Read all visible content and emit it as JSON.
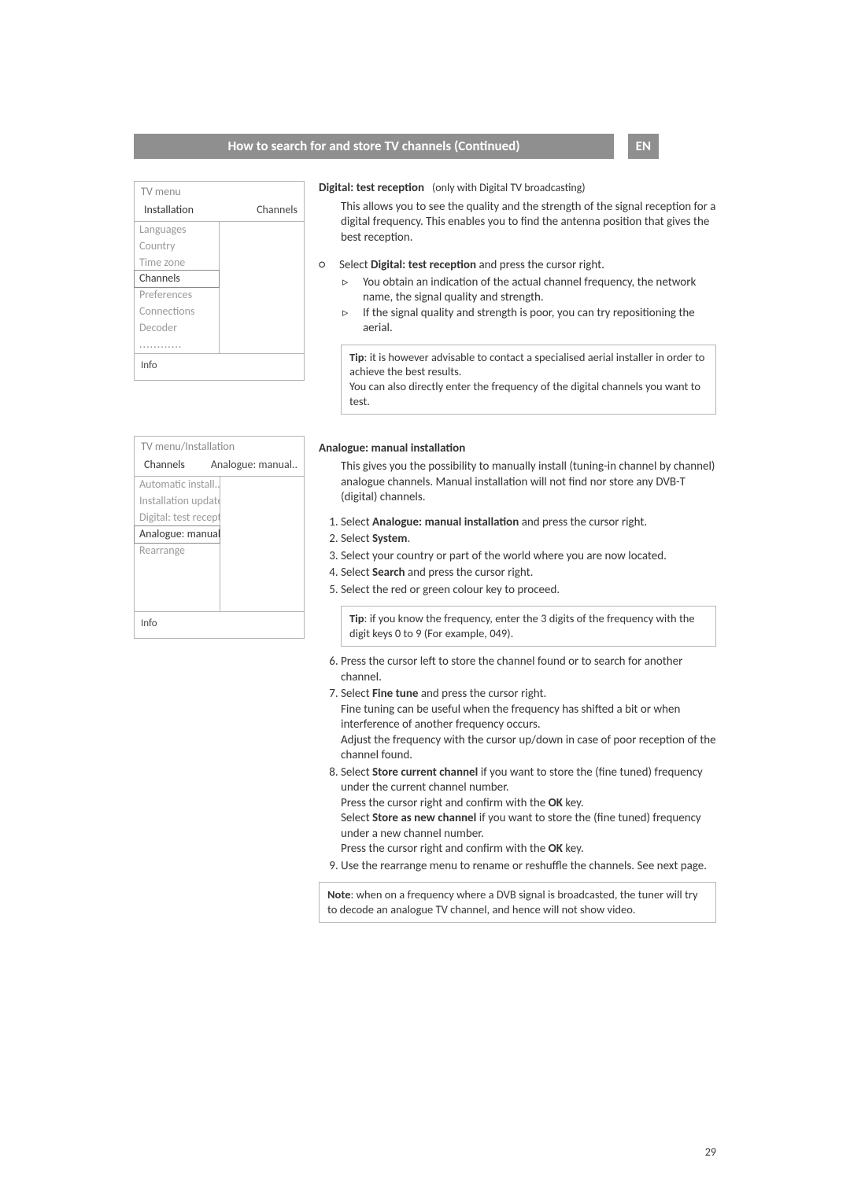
{
  "header": {
    "title": "How to search for and store TV channels  (Continued)",
    "lang": "EN"
  },
  "menu1": {
    "head": "TV menu",
    "crumb_left": "Installation",
    "crumb_right": "Channels",
    "left_items": [
      "Languages",
      "Country",
      "Time zone",
      "Channels",
      "Preferences",
      "Connections",
      "Decoder",
      "............"
    ],
    "selected": "Channels",
    "info": "Info"
  },
  "menu2": {
    "head": "TV menu/Installation",
    "crumb_left": "Channels",
    "crumb_right": "Analogue: manual..",
    "left_items": [
      "Automatic install...",
      "Installation update",
      "Digital: test recept.",
      "Analogue: manual..",
      "Rearrange"
    ],
    "selected": "Analogue: manual..",
    "info": "Info"
  },
  "section_digital": {
    "title": "Digital: test reception",
    "subtitle": "(only with Digital TV broadcasting)",
    "desc": "This allows you to see the quality and the strength of the signal reception for a digital frequency. This enables you to find the antenna position that gives the best reception.",
    "step_bullet": "Select ",
    "step_bold": "Digital: test reception",
    "step_after": " and press the cursor right.",
    "sub1": "You obtain an indication of the actual channel frequency, the network name, the signal quality and strength.",
    "sub2": "If the signal quality and strength is poor, you can try repositioning the aerial.",
    "tip_label": "Tip",
    "tip_text": ": it is however advisable to contact a specialised aerial installer in order to achieve the best results.\nYou can also directly enter the frequency of the digital channels you want to test."
  },
  "section_analogue": {
    "title": "Analogue: manual installation",
    "desc": "This gives you the possibility to manually install (tuning-in channel by channel) analogue channels. Manual installation will not find nor store any DVB-T (digital) channels.",
    "step1_a": "Select ",
    "step1_b": "Analogue: manual installation",
    "step1_c": " and press the cursor right.",
    "step2_a": "Select ",
    "step2_b": "System",
    "step2_c": ".",
    "step3": "Select your country or part of the world where you are now located.",
    "step4_a": "Select ",
    "step4_b": "Search",
    "step4_c": " and press the cursor right.",
    "step5": "Select the red or green colour key to proceed.",
    "tip2_label": "Tip",
    "tip2_text": ": if you know the frequency, enter the 3 digits of the frequency with the digit keys 0 to 9 (For example, 049).",
    "step6": "Press the cursor left to store the channel found or to search for another channel.",
    "step7_a": "Select ",
    "step7_b": "Fine tune",
    "step7_c": " and press the cursor right.\nFine tuning can be useful when the frequency has shifted a bit or when interference of another frequency occurs.\nAdjust the frequency with the cursor up/down in case of poor reception of the channel found.",
    "step8_a": "Select ",
    "step8_b": "Store current channel",
    "step8_c": " if you want to store the (fine tuned) frequency under the current channel number.\nPress the cursor right and confirm with the ",
    "step8_ok1": "OK",
    "step8_d": " key.\nSelect ",
    "step8_e": "Store as new channel",
    "step8_f": " if you want to store the (fine tuned) frequency under a new channel number.\nPress the cursor right and confirm with the ",
    "step8_ok2": "OK",
    "step8_g": " key.",
    "step9": "Use the rearrange menu to rename or reshuffle the channels. See next page.",
    "note_label": "Note",
    "note_text": ": when on a frequency where a DVB signal is broadcasted, the tuner will try to decode an analogue TV channel, and hence will not show video."
  },
  "page_number": "29"
}
